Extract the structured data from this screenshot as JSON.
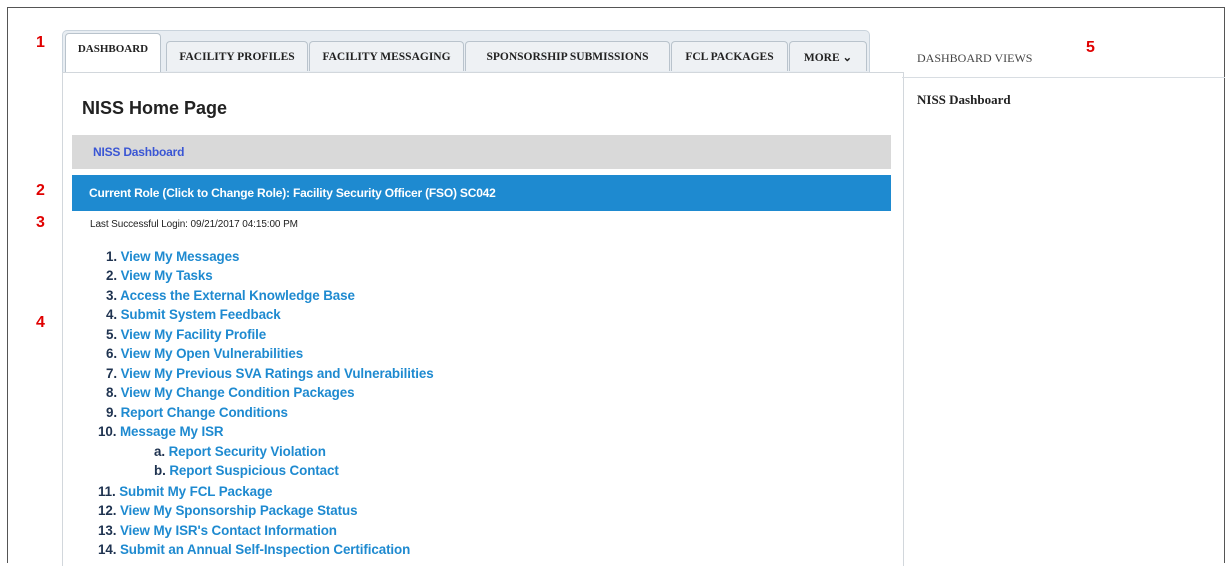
{
  "callouts": [
    "1",
    "2",
    "3",
    "4",
    "5"
  ],
  "tabs": [
    {
      "label": "DASHBOARD",
      "active": true
    },
    {
      "label": "FACILITY PROFILES",
      "active": false
    },
    {
      "label": "FACILITY MESSAGING",
      "active": false
    },
    {
      "label": "SPONSORSHIP SUBMISSIONS",
      "active": false
    },
    {
      "label": "FCL PACKAGES",
      "active": false
    },
    {
      "label": "MORE ⌄",
      "active": false
    }
  ],
  "page": {
    "title": "NISS Home Page",
    "breadcrumb": "NISS Dashboard",
    "role_bar": "Current Role (Click to Change Role): Facility Security Officer (FSO) SC042",
    "last_login": "Last Successful Login: 09/21/2017 04:15:00 PM"
  },
  "menu": [
    {
      "num": "1.",
      "label": "View My Messages"
    },
    {
      "num": "2.",
      "label": "View My Tasks"
    },
    {
      "num": "3.",
      "label": "Access the External Knowledge Base"
    },
    {
      "num": "4.",
      "label": "Submit System Feedback"
    },
    {
      "num": "5.",
      "label": "View My Facility Profile"
    },
    {
      "num": "6.",
      "label": "View My Open Vulnerabilities"
    },
    {
      "num": "7.",
      "label": "View My Previous SVA Ratings and Vulnerabilities"
    },
    {
      "num": "8.",
      "label": "View My Change Condition Packages"
    },
    {
      "num": "9.",
      "label": "Report Change Conditions"
    },
    {
      "num": "10.",
      "label": "Message My ISR"
    },
    {
      "num": "a.",
      "label": "Report Security Violation"
    },
    {
      "num": "b.",
      "label": "Report Suspicious Contact"
    },
    {
      "num": "11.",
      "label": "Submit My FCL Package"
    },
    {
      "num": "12.",
      "label": "View My Sponsorship Package Status"
    },
    {
      "num": "13.",
      "label": "View My ISR's Contact Information"
    },
    {
      "num": "14.",
      "label": "Submit an Annual Self-Inspection Certification"
    }
  ],
  "sidebar": {
    "title": "DASHBOARD VIEWS",
    "item": "NISS Dashboard"
  },
  "colors": {
    "accent": "#1e8ad0",
    "callout": "#e00000",
    "link": "#1e8ad0"
  }
}
